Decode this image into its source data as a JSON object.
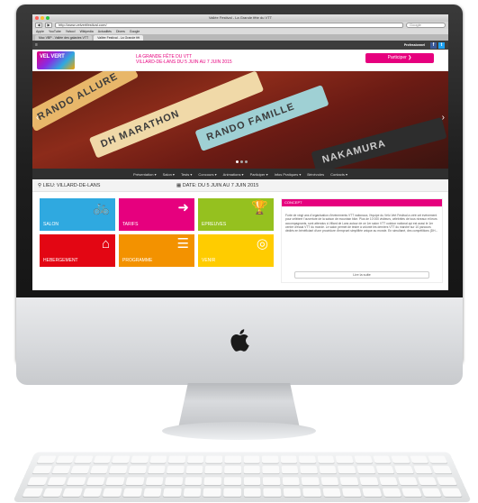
{
  "browser": {
    "window_title": "Vallée Festival - La Grande fête du VTT",
    "url": "http://www.velvertfestival.com/",
    "search_placeholder": "Google",
    "bookmarks": [
      "Apple",
      "YouTube",
      "Yahoo!",
      "Wikipedia",
      "Actualités",
      "Divers",
      "Google"
    ],
    "tabs": [
      "Mac VBP - Vallée des galaxies VTT",
      "Vallée Festival - La Grande fêt"
    ]
  },
  "site": {
    "topbar": {
      "pro_label": "Professionnel",
      "facebook": "f",
      "twitter": "t",
      "menu_icon": "≡"
    },
    "logo_text": "VEL VERT",
    "tagline_line1": "LA GRANDE FÊTE DU VTT",
    "tagline_line2": "VILLARD-DE-LANS DU 5 JUIN AU 7 JUIN 2015",
    "participer_label": "Participer",
    "hero_plates": [
      "RANDO ALLURE",
      "DH MARATHON",
      "RANDO FAMILLE",
      "NAKAMURA"
    ],
    "nav": [
      "Présentation ▾",
      "Salon ▾",
      "Tests ▾",
      "Concours ▾",
      "Animations ▾",
      "Participer ▾",
      "Infos Pratiques ▾",
      "Bénévoles",
      "Contacts ▾"
    ],
    "info": {
      "lieu": "LIEU: VILLARD-DE-LANS",
      "date": "DATE: DU 5 JUIN AU 7 JUIN 2015"
    },
    "tiles": [
      {
        "label": "SALON",
        "color": "#2fa9e0",
        "icon": "bike-icon"
      },
      {
        "label": "TARIFS",
        "color": "#e6007e",
        "icon": "arrow-right-icon"
      },
      {
        "label": "EPREUVES",
        "color": "#95c11f",
        "icon": "trophy-icon"
      },
      {
        "label": "HEBERGEMENT",
        "color": "#e30613",
        "icon": "house-icon"
      },
      {
        "label": "PROGRAMME",
        "color": "#f39200",
        "icon": "list-icon"
      },
      {
        "label": "VENIR",
        "color": "#ffcc00",
        "icon": "compass-icon"
      }
    ],
    "concept": {
      "heading": "CONCEPT",
      "body": "Forte de vingt ans d'organisation d'événements VTT nationaux, l'équipe du Vélo Vert Festival a créé cet événement pour célébrer l'ouverture de la saison de mountain bike. Plus de 10 000 visiteurs, célébrités de tous niveaux et leurs accompagnants, sont attendus à Villard de Lans autour de ce 1er salon VTT outdoor national qui est aussi le 1er centre d'essai VTT du monde. Le salon permet de tester à volonté les derniers VTT du marché sur 10 parcours dédiés en bénéficiant d'une procédure d'emprunt simplifiée unique au monde. En simultané, des compétitions (DH...",
      "button": "Lire la suite"
    }
  }
}
